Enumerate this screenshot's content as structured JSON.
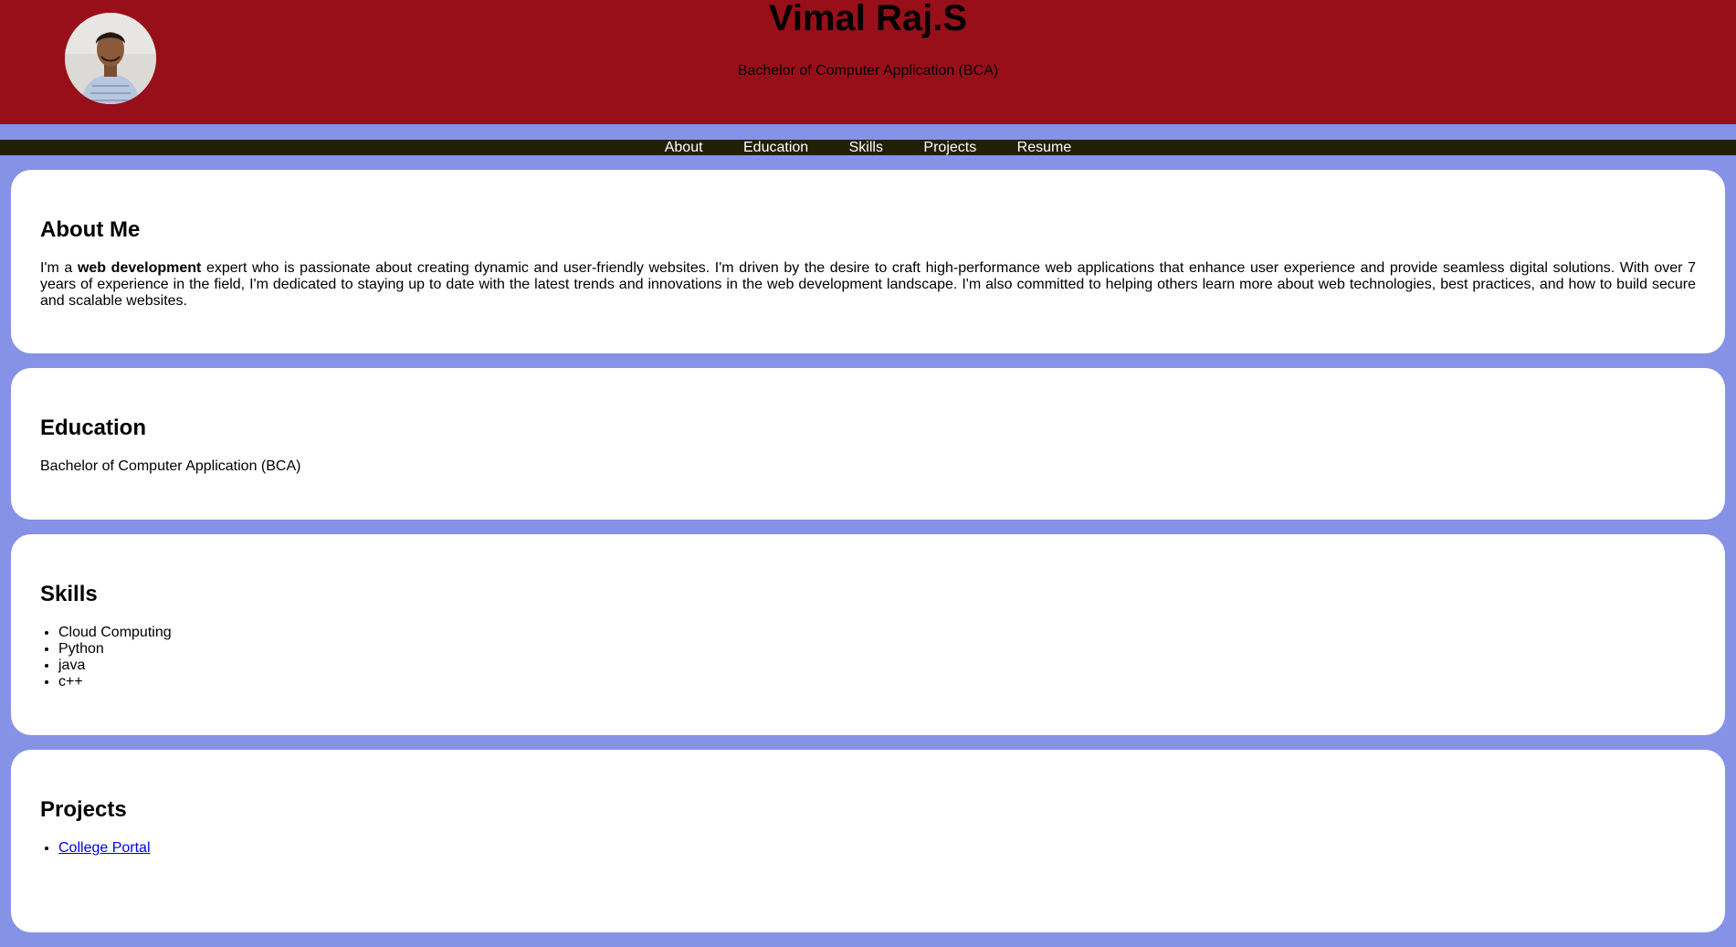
{
  "header": {
    "name": "Vimal Raj.S",
    "subtitle": "Bachelor of Computer Application (BCA)",
    "avatar_icon": "profile-photo"
  },
  "nav": {
    "items": [
      "About",
      "Education",
      "Skills",
      "Projects",
      "Resume"
    ]
  },
  "about": {
    "heading": "About Me",
    "text_before": "I'm a ",
    "text_bold": "web development",
    "text_after": " expert who is passionate about creating dynamic and user-friendly websites. I'm driven by the desire to craft high-performance web applications that enhance user experience and provide seamless digital solutions. With over 7 years of experience in the field, I'm dedicated to staying up to date with the latest trends and innovations in the web development landscape. I'm also committed to helping others learn more about web technologies, best practices, and how to build secure and scalable websites."
  },
  "education": {
    "heading": "Education",
    "text": "Bachelor of Computer Application (BCA)"
  },
  "skills": {
    "heading": "Skills",
    "items": [
      "Cloud Computing",
      "Python",
      "java",
      "c++"
    ]
  },
  "projects": {
    "heading": "Projects",
    "items": [
      "College Portal"
    ]
  },
  "colors": {
    "header_bg": "#990f19",
    "page_bg": "#8592e6",
    "nav_bg": "#222004",
    "link": "#0000ee"
  }
}
